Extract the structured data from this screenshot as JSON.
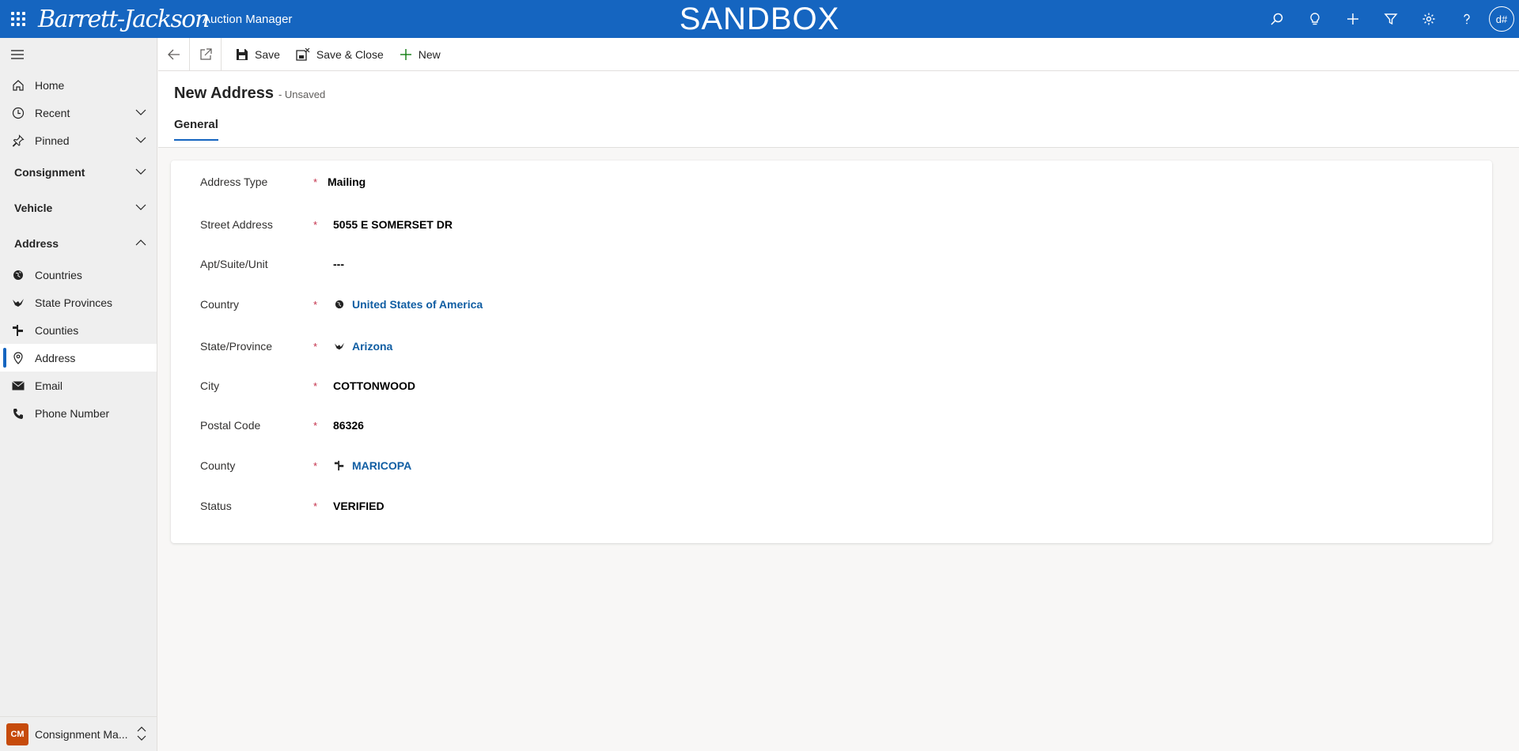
{
  "topbar": {
    "brand": "Barrett-Jackson",
    "app_name": "Auction Manager",
    "environment": "SANDBOX",
    "avatar_initials": "d#",
    "bg_color": "#1565c0"
  },
  "sidebar": {
    "nav": [
      {
        "label": "Home",
        "icon": "home-icon"
      },
      {
        "label": "Recent",
        "icon": "clock-icon"
      },
      {
        "label": "Pinned",
        "icon": "pin-icon"
      }
    ],
    "groups": [
      {
        "label": "Consignment",
        "expanded": false
      },
      {
        "label": "Vehicle",
        "expanded": false
      },
      {
        "label": "Address",
        "expanded": true
      }
    ],
    "address_items": [
      {
        "label": "Countries",
        "icon": "globe-icon"
      },
      {
        "label": "State Provinces",
        "icon": "bird-icon"
      },
      {
        "label": "Counties",
        "icon": "signpost-icon"
      },
      {
        "label": "Address",
        "icon": "location-pin-icon",
        "selected": true
      },
      {
        "label": "Email",
        "icon": "envelope-icon"
      },
      {
        "label": "Phone Number",
        "icon": "phone-icon"
      }
    ],
    "area": {
      "badge": "CM",
      "label": "Consignment Ma..."
    }
  },
  "commandbar": {
    "save": "Save",
    "save_close": "Save & Close",
    "new": "New"
  },
  "form": {
    "title": "New Address",
    "status": "- Unsaved",
    "tab": "General",
    "fields": {
      "address_type": {
        "label": "Address Type",
        "value": "Mailing"
      },
      "street": {
        "label": "Street Address",
        "value": "5055 E SOMERSET DR"
      },
      "apt": {
        "label": "Apt/Suite/Unit",
        "value": "---"
      },
      "country": {
        "label": "Country",
        "value": "United States of America"
      },
      "state": {
        "label": "State/Province",
        "value": "Arizona"
      },
      "city": {
        "label": "City",
        "value": "COTTONWOOD"
      },
      "postal": {
        "label": "Postal Code",
        "value": "86326"
      },
      "county": {
        "label": "County",
        "value": "MARICOPA"
      },
      "status": {
        "label": "Status",
        "value": "VERIFIED"
      }
    },
    "required_mark": "*"
  }
}
